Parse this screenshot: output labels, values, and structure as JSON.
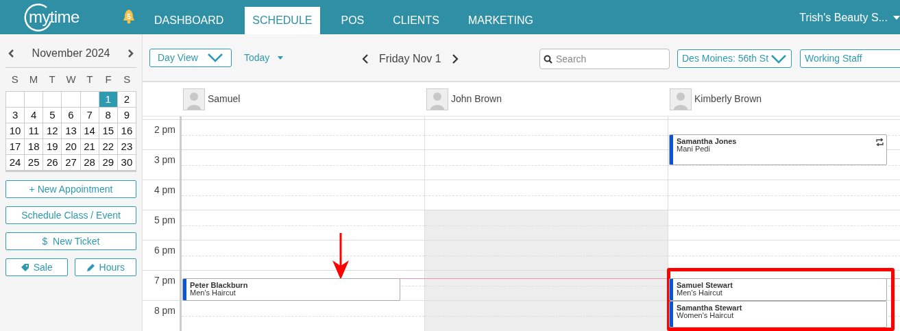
{
  "nav": {
    "logo": "mytime",
    "notifications": "5",
    "tabs": [
      {
        "label": "DASHBOARD",
        "selected": false
      },
      {
        "label": "SCHEDULE",
        "selected": true
      },
      {
        "label": "POS",
        "selected": false
      },
      {
        "label": "CLIENTS",
        "selected": false
      },
      {
        "label": "MARKETING",
        "selected": false
      }
    ],
    "account": "Trish's Beauty S..."
  },
  "sidebar": {
    "calendar": {
      "month": "November 2024",
      "weekdays": [
        "S",
        "M",
        "T",
        "W",
        "T",
        "F",
        "S"
      ],
      "weeks": [
        [
          {
            "label": "1",
            "selected": true
          },
          {
            "label": "2",
            "selected": false
          }
        ],
        [
          {
            "label": "3",
            "selected": false
          },
          {
            "label": "4",
            "selected": false
          },
          {
            "label": "5",
            "selected": false
          },
          {
            "label": "6",
            "selected": false
          },
          {
            "label": "7",
            "selected": false
          },
          {
            "label": "8",
            "selected": false
          },
          {
            "label": "9",
            "selected": false
          }
        ],
        [
          {
            "label": "10",
            "selected": false
          },
          {
            "label": "11",
            "selected": false
          },
          {
            "label": "12",
            "selected": false
          },
          {
            "label": "13",
            "selected": false
          },
          {
            "label": "14",
            "selected": false
          },
          {
            "label": "15",
            "selected": false
          },
          {
            "label": "16",
            "selected": false
          }
        ],
        [
          {
            "label": "17",
            "selected": false
          },
          {
            "label": "18",
            "selected": false
          },
          {
            "label": "19",
            "selected": false
          },
          {
            "label": "20",
            "selected": false
          },
          {
            "label": "21",
            "selected": false
          },
          {
            "label": "22",
            "selected": false
          },
          {
            "label": "23",
            "selected": false
          }
        ],
        [
          {
            "label": "24",
            "selected": false
          },
          {
            "label": "25",
            "selected": false
          },
          {
            "label": "26",
            "selected": false
          },
          {
            "label": "27",
            "selected": false
          },
          {
            "label": "28",
            "selected": false
          },
          {
            "label": "29",
            "selected": false
          },
          {
            "label": "30",
            "selected": false
          }
        ]
      ]
    },
    "buttons": [
      {
        "label": "+ New Appointment"
      },
      {
        "label": "Schedule Class / Event"
      },
      {
        "label": "$  New Ticket"
      }
    ],
    "small_buttons": [
      {
        "label": "Sale",
        "kind": "tag"
      },
      {
        "label": "Hours",
        "kind": "pencil"
      }
    ]
  },
  "toolbar": {
    "view": "Day View",
    "today": "Today",
    "date": "Friday Nov 1",
    "search": {
      "placeholder": "Search"
    },
    "location": "Des Moines: 56th St",
    "staff_filter": "Working Staff"
  },
  "schedule": {
    "hours": [
      "2 pm",
      "3 pm",
      "4 pm",
      "5 pm",
      "6 pm",
      "7 pm",
      "8 pm"
    ],
    "staff": [
      {
        "name": "Samuel",
        "unavailable": false,
        "appointments": [
          {
            "client": "Peter Blackburn",
            "service": "Men's Haircut",
            "color": "#0b55d4",
            "recurring": false
          }
        ]
      },
      {
        "name": "John Brown",
        "unavailable": true
      },
      {
        "name": "Kimberly Brown",
        "unavailable": false,
        "appointments": [
          {
            "client": "Samantha Jones",
            "service": "Mani Pedi",
            "color": "#0b55d4",
            "recurring": true
          },
          {
            "client": "Samuel Stewart",
            "service": "Men's Haircut",
            "color": "#0b55d4",
            "recurring": false
          },
          {
            "client": "Samantha Stewart",
            "service": "Women's Haircut",
            "color": "#0b55d4",
            "recurring": false
          }
        ]
      }
    ]
  },
  "annotation_arrow": true,
  "highlight_box": true
}
